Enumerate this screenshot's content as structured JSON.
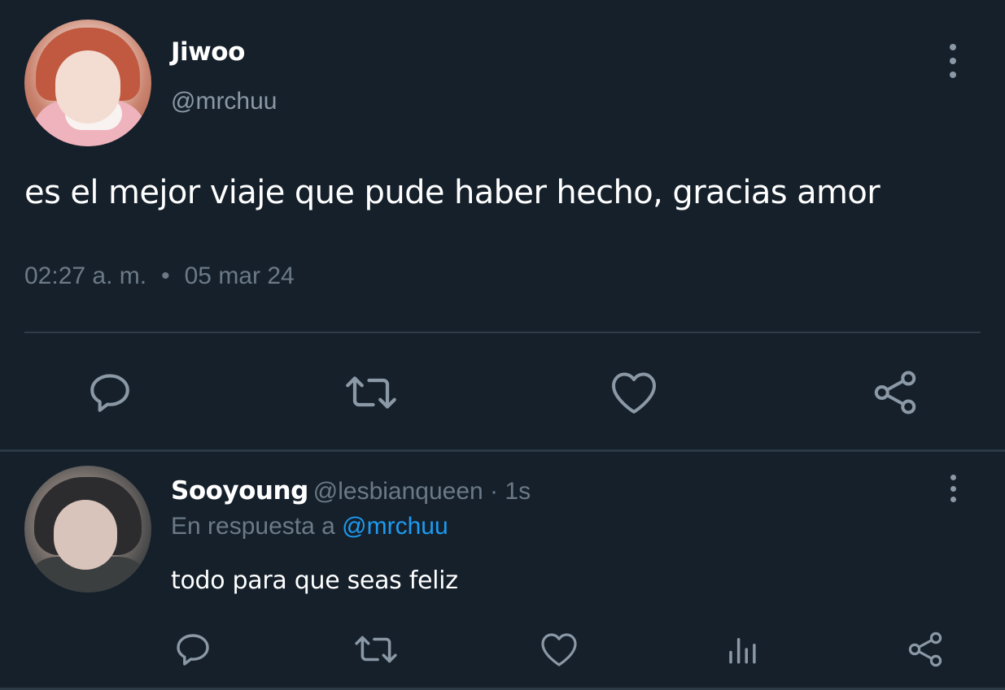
{
  "colors": {
    "background": "#15202b",
    "primary_text": "#ffffff",
    "secondary_text": "#8b98a5",
    "muted_text": "#6c7a87",
    "link": "#1d9bf0",
    "icon": "#8b98a5",
    "divider": "#2f3c47"
  },
  "main_tweet": {
    "author": {
      "name": "Jiwoo",
      "handle": "@mrchuu"
    },
    "text": "es el mejor viaje que pude haber hecho, gracias amor",
    "time": "02:27 a. m.",
    "separator": "•",
    "date": "05 mar 24",
    "actions": [
      {
        "name": "reply",
        "icon": "speech-bubble-icon"
      },
      {
        "name": "retweet",
        "icon": "retweet-arrows-icon"
      },
      {
        "name": "like",
        "icon": "heart-icon"
      },
      {
        "name": "share",
        "icon": "share-nodes-icon"
      }
    ],
    "more_icon": "vertical-ellipsis-icon"
  },
  "reply": {
    "author": {
      "name": "Sooyoung",
      "handle": "@lesbianqueen"
    },
    "time_separator": " · ",
    "time": "1s",
    "reply_to_prefix": "En respuesta a",
    "reply_to_handle": "@mrchuu",
    "text": "todo para que seas feliz",
    "actions": [
      {
        "name": "reply",
        "icon": "speech-bubble-icon"
      },
      {
        "name": "retweet",
        "icon": "retweet-arrows-icon"
      },
      {
        "name": "like",
        "icon": "heart-icon"
      },
      {
        "name": "views",
        "icon": "bar-chart-icon"
      },
      {
        "name": "share",
        "icon": "share-nodes-icon"
      }
    ],
    "more_icon": "vertical-ellipsis-icon"
  }
}
